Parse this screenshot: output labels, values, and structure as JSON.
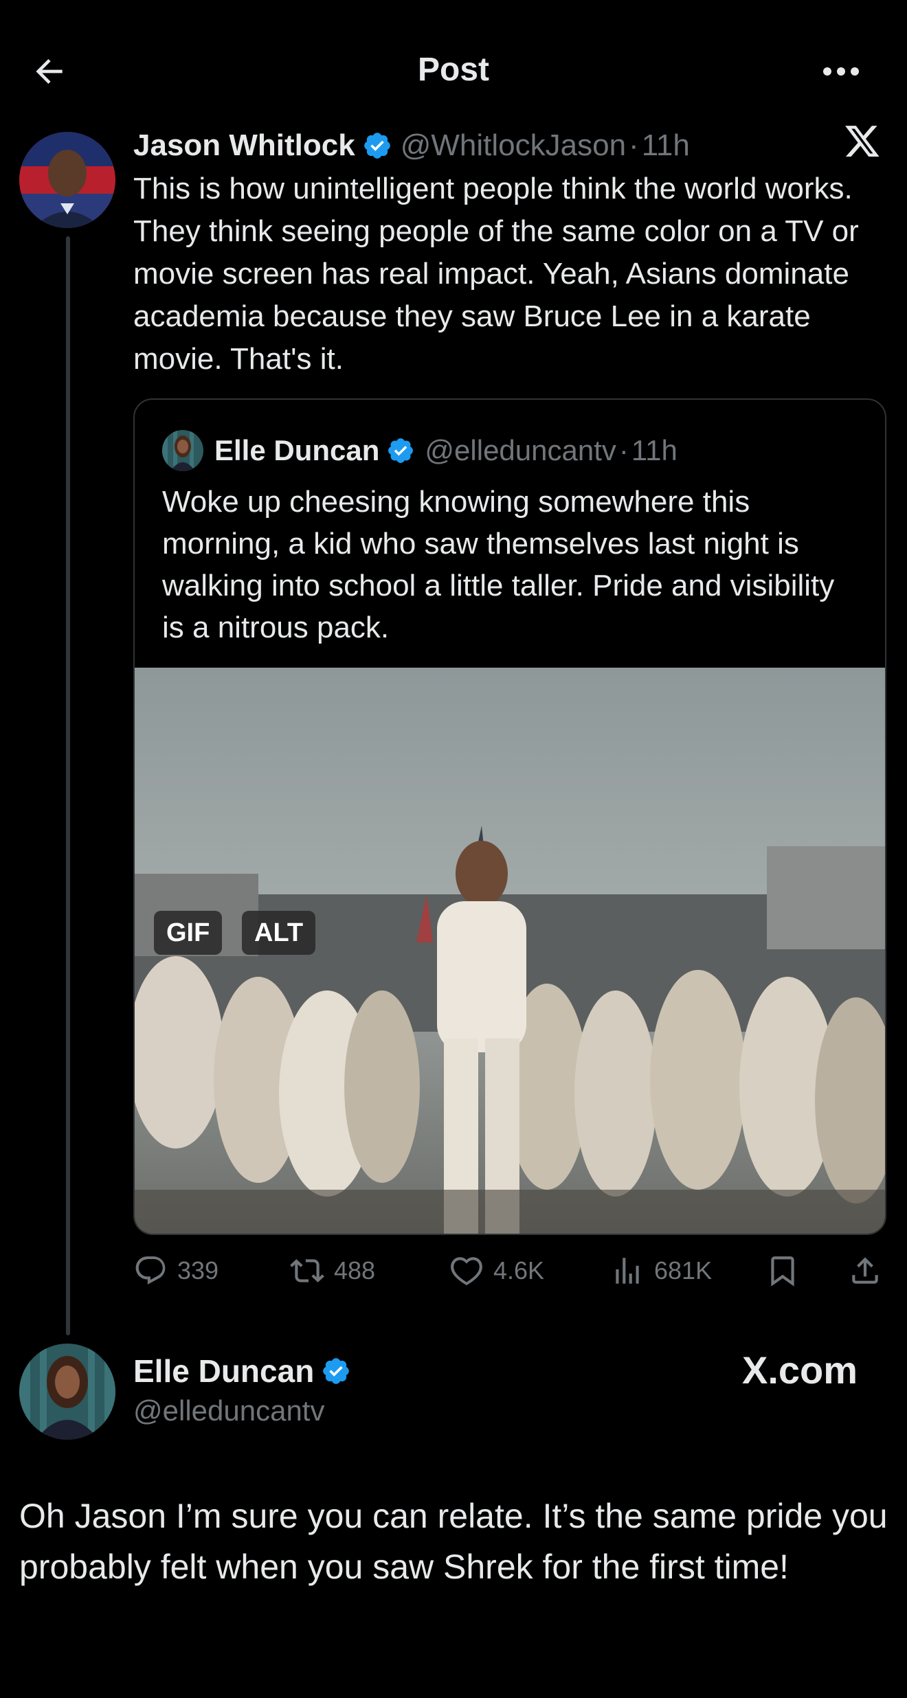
{
  "header": {
    "title": "Post"
  },
  "post": {
    "author_name": "Jason Whitlock",
    "author_handle": "@WhitlockJason",
    "separator": "·",
    "time": "11h",
    "text": "This is how unintelligent people think the world works. They think seeing people of the same color on a TV or movie screen has real impact. Yeah, Asians dominate academia because they saw Bruce Lee in a karate movie. That's it."
  },
  "quote": {
    "author_name": "Elle Duncan",
    "author_handle": "@elleduncantv",
    "separator": "·",
    "time": "11h",
    "text": "Woke up cheesing knowing somewhere this morning, a kid who saw themselves last night is walking into school a little taller. Pride and visibility is a nitrous pack.",
    "badges": {
      "gif": "GIF",
      "alt": "ALT"
    }
  },
  "actions": {
    "replies": "339",
    "reposts": "488",
    "likes": "4.6K",
    "views": "681K"
  },
  "reply": {
    "author_name": "Elle Duncan",
    "author_handle": "@elleduncantv",
    "watermark": "X.com",
    "text": "Oh Jason I’m sure you can relate. It’s the same pride you probably felt when you saw Shrek for the first time!"
  },
  "colors": {
    "background": "#000000",
    "text": "#e7e9ea",
    "muted": "#71767b",
    "verified": "#1d9bf0",
    "border": "#2f3336"
  },
  "icons": [
    "back-arrow-icon",
    "more-icon",
    "verified-badge-icon",
    "x-logo-icon",
    "reply-icon",
    "repost-icon",
    "like-icon",
    "views-icon",
    "bookmark-icon",
    "share-icon"
  ]
}
